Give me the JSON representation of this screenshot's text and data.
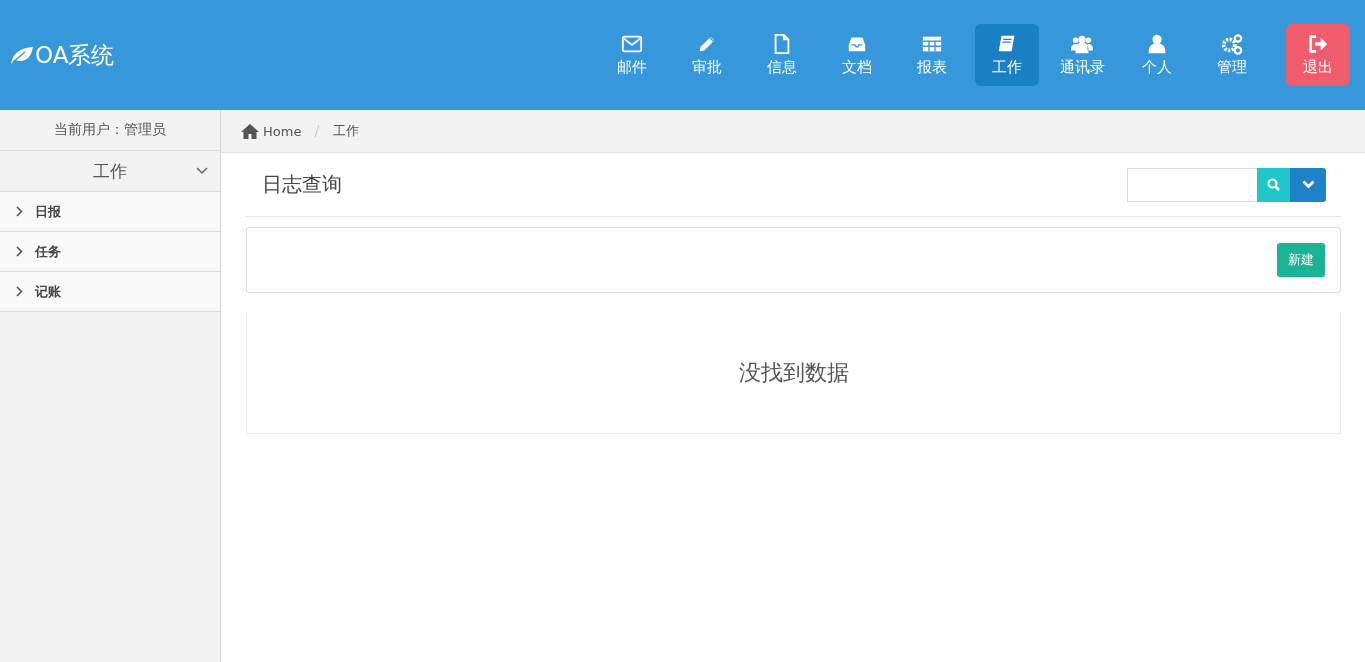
{
  "header": {
    "logo": "OA系统",
    "nav": [
      {
        "label": "邮件",
        "selected": false,
        "kind": "normal"
      },
      {
        "label": "审批",
        "selected": false,
        "kind": "normal"
      },
      {
        "label": "信息",
        "selected": false,
        "kind": "normal"
      },
      {
        "label": "文档",
        "selected": false,
        "kind": "normal"
      },
      {
        "label": "报表",
        "selected": false,
        "kind": "normal"
      },
      {
        "label": "工作",
        "selected": true,
        "kind": "normal"
      },
      {
        "label": "通讯录",
        "selected": false,
        "kind": "normal"
      },
      {
        "label": "个人",
        "selected": false,
        "kind": "normal"
      },
      {
        "label": "管理",
        "selected": false,
        "kind": "normal"
      },
      {
        "label": "退出",
        "selected": false,
        "kind": "danger"
      }
    ]
  },
  "sidebar": {
    "current_user": "当前用户：管理员",
    "section": {
      "title": "工作",
      "expanded": true,
      "items": [
        {
          "label": "日报"
        },
        {
          "label": "任务"
        },
        {
          "label": "记账"
        }
      ]
    }
  },
  "breadcrumb": [
    "Home",
    "工作"
  ],
  "page": {
    "title": "日志查询",
    "new_button": "新建",
    "empty_message": "没找到数据"
  }
}
